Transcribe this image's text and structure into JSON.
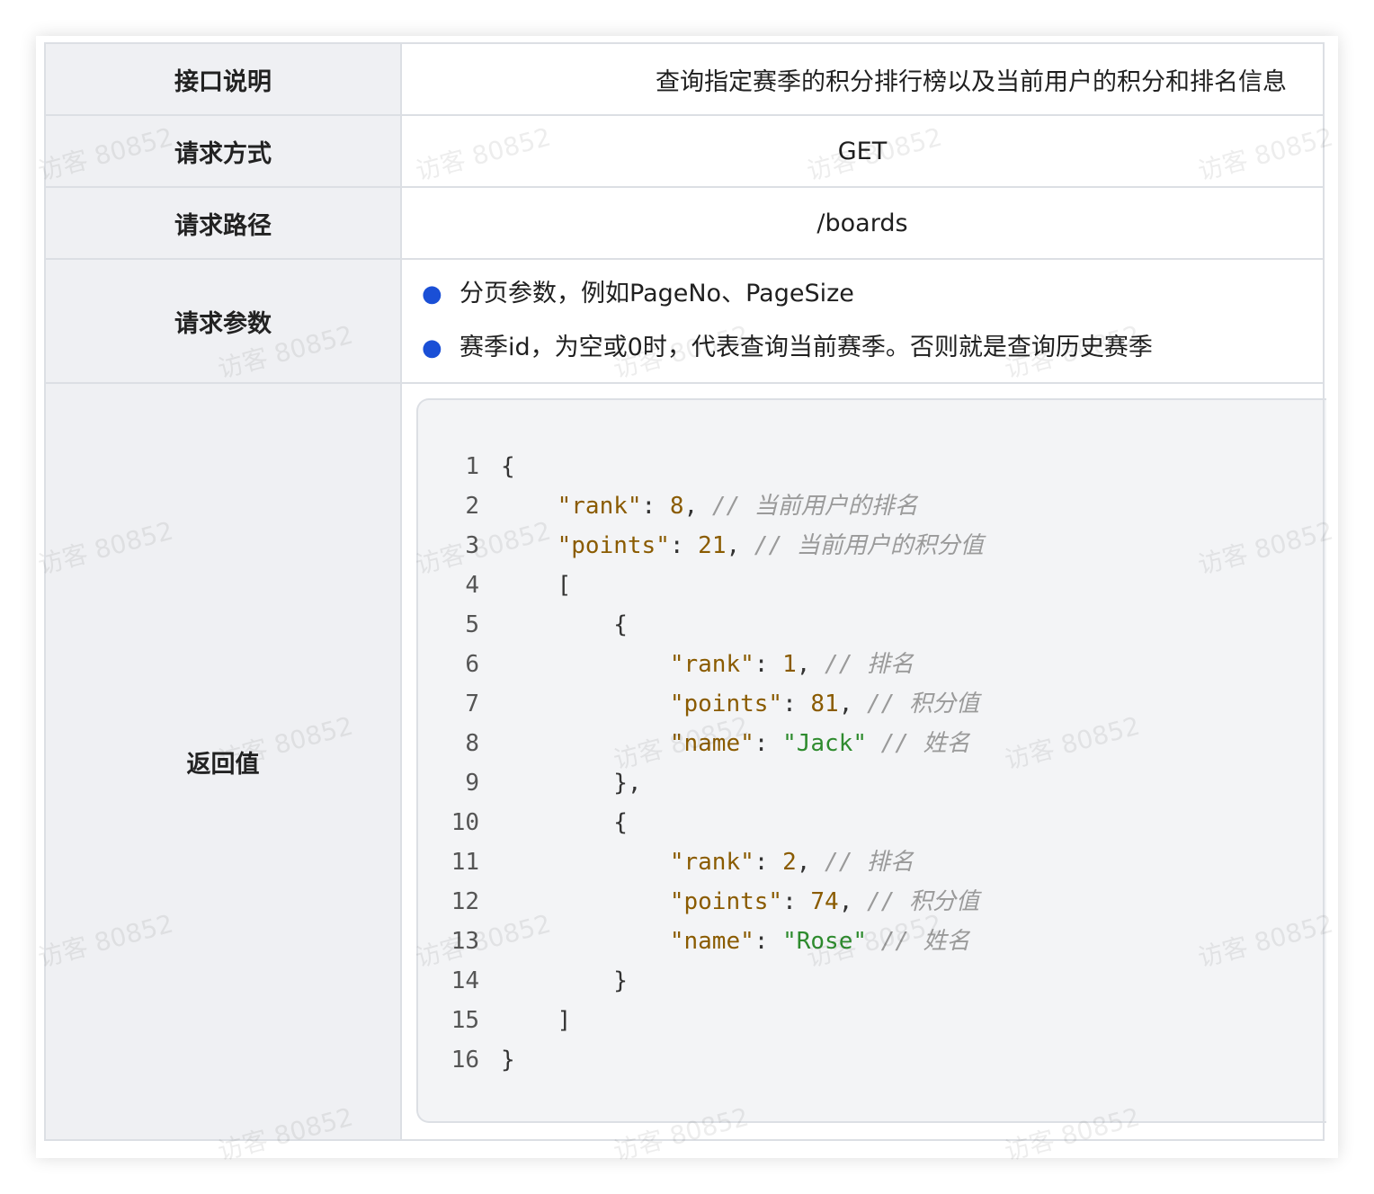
{
  "rows": {
    "description": {
      "label": "接口说明",
      "value": "查询指定赛季的积分排行榜以及当前用户的积分和排名信息"
    },
    "method": {
      "label": "请求方式",
      "value": "GET"
    },
    "path": {
      "label": "请求路径",
      "value": "/boards"
    },
    "params": {
      "label": "请求参数",
      "items": [
        "分页参数，例如PageNo、PageSize",
        "赛季id，为空或0时，代表查询当前赛季。否则就是查询历史赛季"
      ]
    },
    "return": {
      "label": "返回值"
    }
  },
  "code": {
    "line_numbers": [
      "1",
      "2",
      "3",
      "4",
      "5",
      "6",
      "7",
      "8",
      "9",
      "10",
      "11",
      "12",
      "13",
      "14",
      "15",
      "16"
    ],
    "l1": "{",
    "l2": {
      "key": "\"rank\"",
      "sep": ": ",
      "val": "8",
      "end": ", ",
      "com": "// 当前用户的排名"
    },
    "l3": {
      "key": "\"points\"",
      "sep": ": ",
      "val": "21",
      "end": ", ",
      "com": "// 当前用户的积分值"
    },
    "l4": "[",
    "l5": "{",
    "l6": {
      "key": "\"rank\"",
      "sep": ": ",
      "val": "1",
      "end": ", ",
      "com": "// 排名"
    },
    "l7": {
      "key": "\"points\"",
      "sep": ": ",
      "val": "81",
      "end": ", ",
      "com": "// 积分值"
    },
    "l8": {
      "key": "\"name\"",
      "sep": ": ",
      "val": "\"Jack\"",
      "end": " ",
      "com": "// 姓名"
    },
    "l9": "},",
    "l10": "{",
    "l11": {
      "key": "\"rank\"",
      "sep": ": ",
      "val": "2",
      "end": ", ",
      "com": "// 排名"
    },
    "l12": {
      "key": "\"points\"",
      "sep": ": ",
      "val": "74",
      "end": ", ",
      "com": "// 积分值"
    },
    "l13": {
      "key": "\"name\"",
      "sep": ": ",
      "val": "\"Rose\"",
      "end": " ",
      "com": "// 姓名"
    },
    "l14": "}",
    "l15": "]",
    "l16": "}"
  },
  "watermark": "访客 80852",
  "colors": {
    "bullet": "#1a4fd6",
    "label_bg": "#eff0f3",
    "code_bg": "#f3f4f6",
    "string": "#2e8b2e",
    "key": "#8a5b00"
  }
}
